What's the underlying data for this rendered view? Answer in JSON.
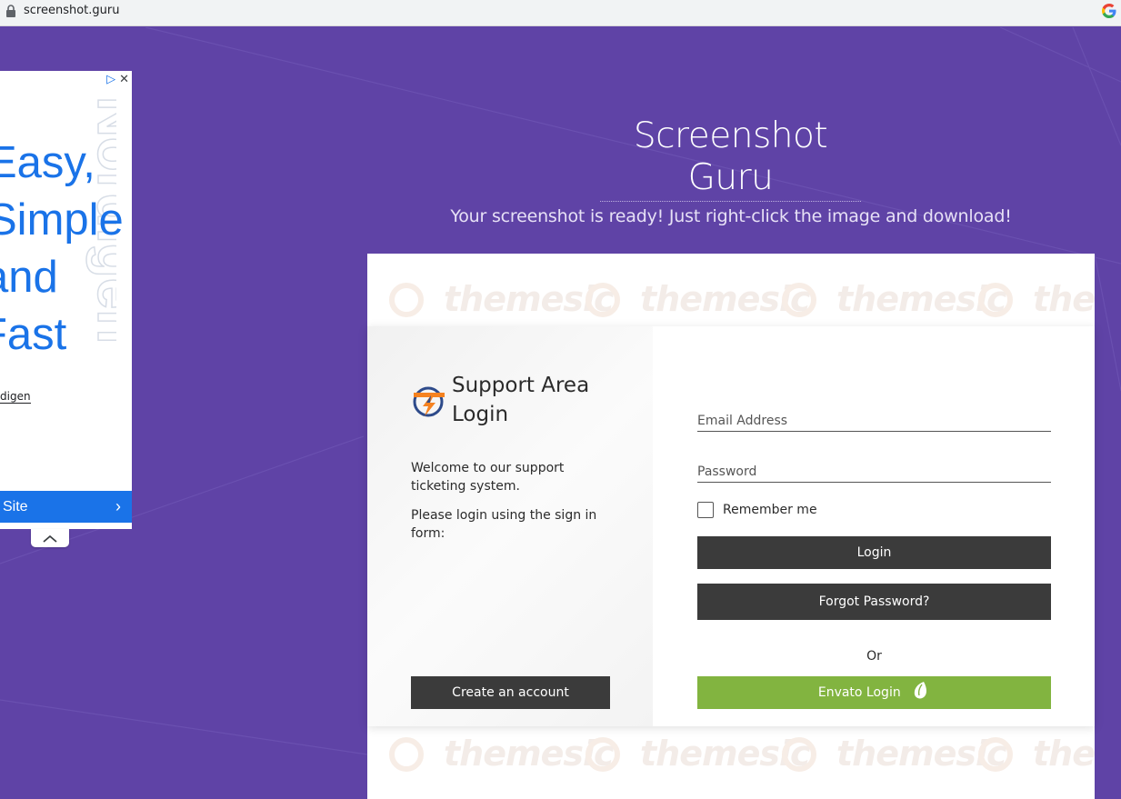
{
  "browser": {
    "url": "screenshot.guru"
  },
  "page": {
    "title": "Screenshot Guru",
    "subtitle": "Your screenshot is ready! Just right-click the image and download!"
  },
  "ad": {
    "lines": [
      "Easy,",
      "Simple",
      "and",
      "Fast"
    ],
    "vertical_text": "Nordigen",
    "link_text": "digen",
    "button_label": "Site"
  },
  "watermark": {
    "text": "themesic"
  },
  "login": {
    "brand_title": "Support Area Login",
    "welcome": "Welcome to our support ticketing system.",
    "please": "Please login using the sign in form:",
    "create_account": "Create an account",
    "email_placeholder": "Email Address",
    "password_placeholder": "Password",
    "remember_me": "Remember me",
    "login_button": "Login",
    "forgot_button": "Forgot Password?",
    "or": "Or",
    "envato_button": "Envato Login"
  },
  "colors": {
    "background": "#5f43a6",
    "dark_button": "#3b3b3b",
    "envato_green": "#82b440",
    "ad_blue": "#1a73e8"
  }
}
